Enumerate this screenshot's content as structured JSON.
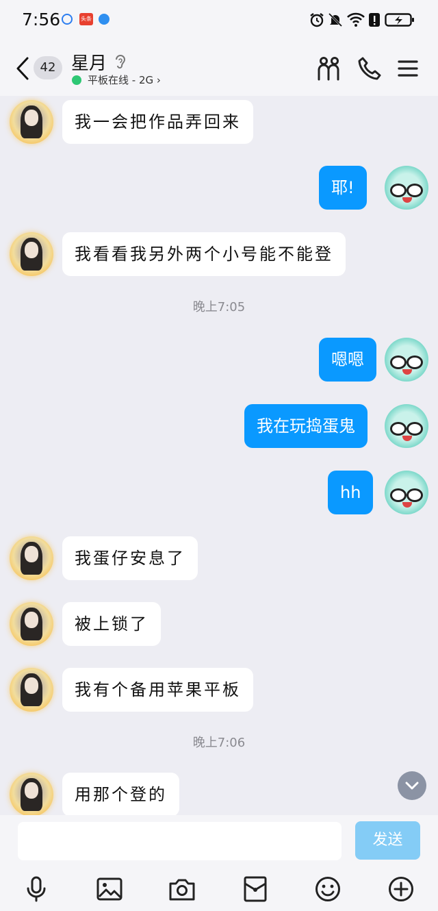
{
  "status_bar": {
    "time": "7:56",
    "app_icon_labels": [
      "头条"
    ]
  },
  "header": {
    "unread_count": "42",
    "contact_name": "星月",
    "online_status": "平板在线 - 2G ›"
  },
  "messages": [
    {
      "side": "left",
      "text": "我一会把作品弄回来"
    },
    {
      "side": "right",
      "text": "耶!"
    },
    {
      "side": "left",
      "text": "我看看我另外两个小号能不能登"
    },
    {
      "side": "time",
      "text": "晚上7:05"
    },
    {
      "side": "right",
      "text": "嗯嗯"
    },
    {
      "side": "right",
      "text": "我在玩捣蛋鬼"
    },
    {
      "side": "right",
      "text": "hh"
    },
    {
      "side": "left",
      "text": "我蛋仔安息了"
    },
    {
      "side": "left",
      "text": "被上锁了"
    },
    {
      "side": "left",
      "text": "我有个备用苹果平板"
    },
    {
      "side": "time",
      "text": "晚上7:06"
    },
    {
      "side": "left",
      "text": "用那个登的"
    }
  ],
  "input": {
    "value": "",
    "send_label": "发送"
  },
  "toolbar": [
    "mic-icon",
    "image-icon",
    "camera-icon",
    "red-packet-icon",
    "emoji-icon",
    "plus-icon"
  ],
  "colors": {
    "accent": "#0a99ff",
    "send_disabled": "#84ccf6",
    "background": "#ededf3",
    "online": "#2ec774"
  }
}
